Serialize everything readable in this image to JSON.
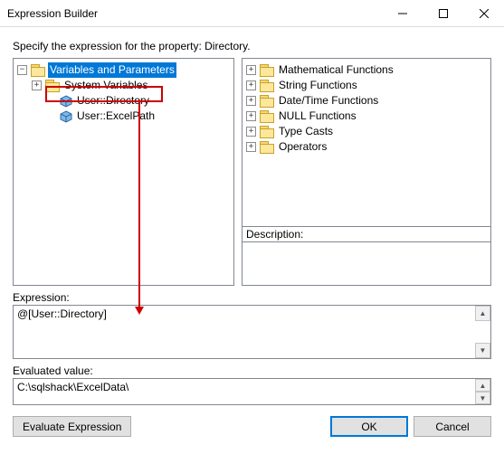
{
  "window": {
    "title": "Expression Builder",
    "instruction": "Specify the expression for the property: Directory."
  },
  "var_tree": {
    "root": "Variables and Parameters",
    "system": "System Variables",
    "user_directory": "User::Directory",
    "user_excelpath": "User::ExcelPath"
  },
  "func_tree": {
    "items": [
      "Mathematical Functions",
      "String Functions",
      "Date/Time Functions",
      "NULL Functions",
      "Type Casts",
      "Operators"
    ]
  },
  "labels": {
    "description": "Description:",
    "expression": "Expression:",
    "evaluated": "Evaluated value:"
  },
  "expression_value": "@[User::Directory]",
  "evaluated_value": "C:\\sqlshack\\ExcelData\\",
  "buttons": {
    "evaluate": "Evaluate Expression",
    "ok": "OK",
    "cancel": "Cancel"
  }
}
